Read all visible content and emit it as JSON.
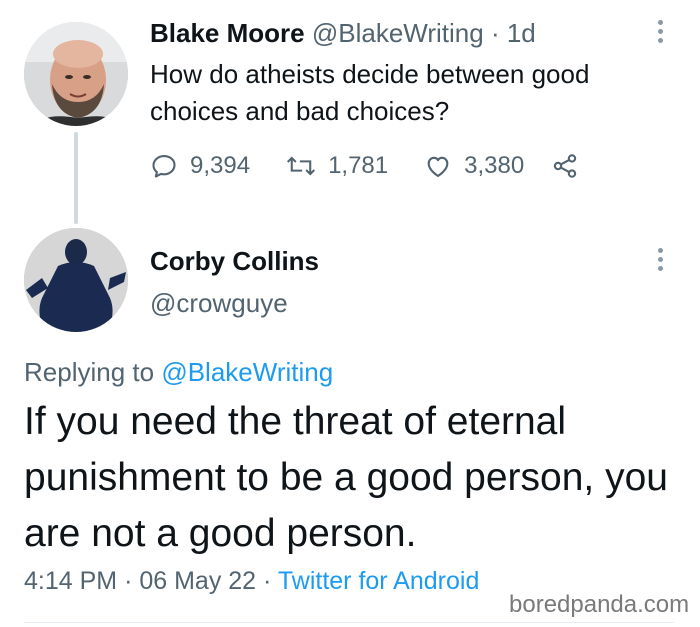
{
  "original_tweet": {
    "author_name": "Blake Moore",
    "author_handle": "@BlakeWriting",
    "separator": "·",
    "time_ago": "1d",
    "text": "How do atheists decide between good choices and bad choices?",
    "replies": "9,394",
    "retweets": "1,781",
    "likes": "3,380"
  },
  "reply_tweet": {
    "author_name": "Corby Collins",
    "author_handle": "@crowguye",
    "replying_prefix": "Replying to",
    "replying_to": "@BlakeWriting",
    "text": "If you need the threat of eternal punishment to be a good person, you are not a good person.",
    "time": "4:14 PM",
    "date": "06 May 22",
    "separator": "·",
    "source": "Twitter for Android"
  },
  "watermark": "boredpanda.com",
  "icons": {
    "reply": "reply-icon",
    "retweet": "retweet-icon",
    "like": "heart-icon",
    "share": "share-icon",
    "more": "more-options-icon"
  },
  "colors": {
    "link": "#1d9bf0",
    "muted": "#536471",
    "text": "#0f1419"
  }
}
